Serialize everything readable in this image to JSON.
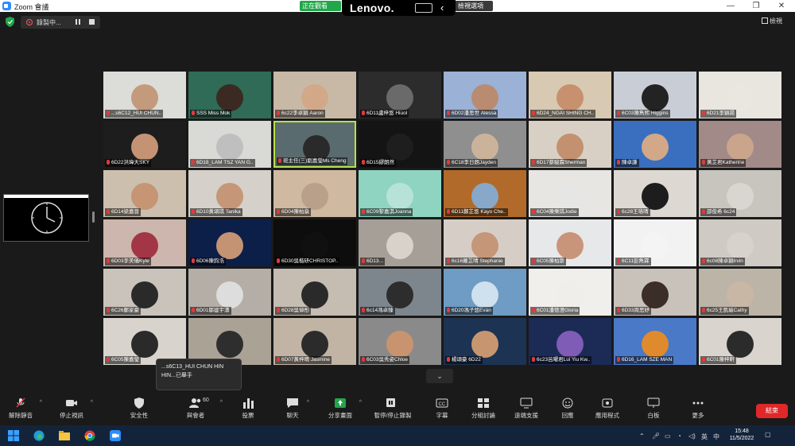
{
  "titlebar": {
    "app_title": "Zoom 會議",
    "recording_pill": "正在觀看",
    "view_pill": "檢視選項",
    "minimize": "—",
    "maximize": "❐",
    "close": "✕"
  },
  "lenovo": {
    "brand": "Lenovo."
  },
  "recording": {
    "label": "錄製中...",
    "view_label": "檢視"
  },
  "grid_tiles": [
    {
      "label": "...s6C12_HUI CHUN..",
      "bg": "#dcdcd8",
      "face": "#c49a7c"
    },
    {
      "label": "SSS Miss Mok",
      "bg": "#2f6b57",
      "face": "#3a2a22"
    },
    {
      "label": "6c22李卓穎 Aaron",
      "bg": "#c7b9a6",
      "face": "#d2a888"
    },
    {
      "label": "6D11盧梓悠 Hiuol",
      "bg": "#2c2c2c",
      "face": "#6a6a6a"
    },
    {
      "label": "6D02潘思世 Alessa",
      "bg": "#9bb1d6",
      "face": "#b98b70"
    },
    {
      "label": "6D24_NGAI SHING CH..",
      "bg": "#d8c9b2",
      "face": "#c7906e"
    },
    {
      "label": "6C03陳雋熙 Higgins",
      "bg": "#c9ced6",
      "face": "#232323"
    },
    {
      "label": "6D21李穎揚",
      "bg": "#e9e6e0",
      "face": "#eae7e1"
    },
    {
      "label": "6D22洪瑋天SKY",
      "bg": "#1d1d1d",
      "face": "#c39374"
    },
    {
      "label": "6D18_LAM TSZ YAN G..",
      "bg": "#d9d9d5",
      "face": "#bfbfbf"
    },
    {
      "label": "班主任(三)劉嘉瑩Ms Cheng",
      "bg": "#5a6b6f",
      "face": "#2a2a2a"
    },
    {
      "label": "6D15繆朗然",
      "bg": "#141414",
      "face": "#1e1e1e"
    },
    {
      "label": "6C18李日朗Jayden",
      "bg": "#8f8f8f",
      "face": "#cbb39b"
    },
    {
      "label": "6D17蔡駿霖Sherman",
      "bg": "#d8d0c4",
      "face": "#c39170"
    },
    {
      "label": "陳卓謙",
      "bg": "#3a6fbf",
      "face": "#d2a888"
    },
    {
      "label": "黃芷君Katherine",
      "bg": "#a28a88",
      "face": "#caa58c"
    },
    {
      "label": "6D14梁嘉晉",
      "bg": "#cdbfae",
      "face": "#c59574"
    },
    {
      "label": "6D10黃頌琪 Tanika",
      "bg": "#d5d0c9",
      "face": "#c59678"
    },
    {
      "label": "6D04陳柏燊",
      "bg": "#cfb9a1",
      "face": "#b8a08a"
    },
    {
      "label": "6C09黎嘉淇Joanna",
      "bg": "#8fd4c1",
      "face": "#b7e2d8"
    },
    {
      "label": "6D11鄭芷悠 Kayo Che..",
      "bg": "#b26a2a",
      "face": "#87a8c8"
    },
    {
      "label": "6C04陳樂琪Jodie",
      "bg": "#e8e6e2",
      "face": "#e6e6e4"
    },
    {
      "label": "6c28王珞晴",
      "bg": "#ddd8d2",
      "face": "#1d1d1d"
    },
    {
      "label": "邵俊希 6c24",
      "bg": "#c8c4be",
      "face": "#d9d6d1"
    },
    {
      "label": "6D03李美儀Kyle",
      "bg": "#cdb6ad",
      "face": "#a23646"
    },
    {
      "label": "6D06陳鈞浩",
      "bg": "#0c1f49",
      "face": "#c39374"
    },
    {
      "label": "6D30吳楷研CHRISTOP..",
      "bg": "#0d0d0d",
      "face": "#101010"
    },
    {
      "label": "6D13...",
      "bg": "#a69f97",
      "face": "#d8d2cb"
    },
    {
      "label": "6c16羅芷晴 Stephanie",
      "bg": "#d6cec6",
      "face": "#c59678"
    },
    {
      "label": "6C05陳柏斯",
      "bg": "#e7e8ea",
      "face": "#c9957a"
    },
    {
      "label": "6C11彭雋霖",
      "bg": "#f2f2f2",
      "face": "#f4f4f4"
    },
    {
      "label": "6c08陳卓穎Irvin",
      "bg": "#cfcac4",
      "face": "#d7d2cc"
    },
    {
      "label": "6C26鄭家豪",
      "bg": "#c9c3bb",
      "face": "#2a2a2a"
    },
    {
      "label": "6D01鄒建宇濤",
      "bg": "#b5aea6",
      "face": "#ddd"
    },
    {
      "label": "6D28吳倬彤",
      "bg": "#c5bcb2",
      "face": "#2a2a2a"
    },
    {
      "label": "6c14馮卓臻",
      "bg": "#7d868c",
      "face": "#2d2d2d"
    },
    {
      "label": "6D20馮子悠Evan",
      "bg": "#6e9cc4",
      "face": "#cfe1ef"
    },
    {
      "label": "6C01潘德澄Gloria",
      "bg": "#f0efec",
      "face": "#efeeea"
    },
    {
      "label": "6D33周思妤",
      "bg": "#c9c2bb",
      "face": "#3b2d27"
    },
    {
      "label": "6c25王凱瑜Cathy",
      "bg": "#bdb4a8",
      "face": "#c8b7a4"
    },
    {
      "label": "6C05陳嘉瑩",
      "bg": "#d8d3cc",
      "face": "#2a2a2a"
    },
    {
      "label": "",
      "bg": "#aba296",
      "face": "#2e2e2e"
    },
    {
      "label": "6D07黃梓晴 Jasmine",
      "bg": "#c1b4a5",
      "face": "#2b2b2b"
    },
    {
      "label": "6C03吳秀姿Chloe",
      "bg": "#8a8a8a",
      "face": "#c8946f"
    },
    {
      "label": "楊頌豪 6D22",
      "bg": "#1d3353",
      "face": "#c79670"
    },
    {
      "label": "6c23呂曜君Lui Yiu Kw..",
      "bg": "#1c2b55",
      "face": "#7f5cb6"
    },
    {
      "label": "6D16_LAM SZE MAN",
      "bg": "#4a79c7",
      "face": "#e08a2e"
    },
    {
      "label": "6C01陳梓軒",
      "bg": "#d9d4ce",
      "face": "#2b2b2b"
    }
  ],
  "popup": {
    "line1": "...s6C13_HUI CHUN HIN",
    "line2": "HIN...已舉手"
  },
  "toolbar": {
    "unmute": "解除靜音",
    "stop_video": "停止視訊",
    "security": "安全性",
    "participants": "與會者",
    "participants_count": "60",
    "polls": "投票",
    "chat": "聊天",
    "share_screen": "分享畫面",
    "pause_recording": "暫停/停止錄製",
    "captions": "字幕",
    "breakout": "分組討論",
    "remote_support": "遠端支援",
    "reactions": "回應",
    "apps": "應用程式",
    "whiteboard": "白板",
    "more": "更多",
    "end": "結束"
  },
  "taskbar": {
    "time": "15:48",
    "date": "11/5/2022",
    "ime": "英",
    "ime2": "中"
  },
  "colors": {
    "accent_green": "#21a64a",
    "end_red": "#e02828",
    "zoom_blue": "#2d8cff",
    "active_border": "#b6e04a"
  }
}
